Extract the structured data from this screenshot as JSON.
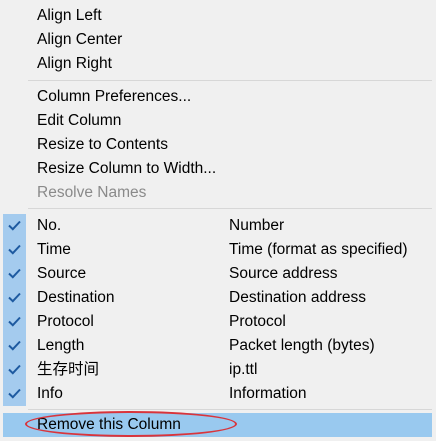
{
  "menu": {
    "align": [
      {
        "label": "Align Left"
      },
      {
        "label": "Align Center"
      },
      {
        "label": "Align Right"
      }
    ],
    "column_actions": [
      {
        "label": "Column Preferences...",
        "enabled": true
      },
      {
        "label": "Edit Column",
        "enabled": true
      },
      {
        "label": "Resize to Contents",
        "enabled": true
      },
      {
        "label": "Resize Column to Width...",
        "enabled": true
      },
      {
        "label": "Resolve Names",
        "enabled": false
      }
    ],
    "columns": [
      {
        "label": "No.",
        "desc": "Number",
        "checked": true
      },
      {
        "label": "Time",
        "desc": "Time (format as specified)",
        "checked": true
      },
      {
        "label": "Source",
        "desc": "Source address",
        "checked": true
      },
      {
        "label": "Destination",
        "desc": "Destination address",
        "checked": true
      },
      {
        "label": "Protocol",
        "desc": "Protocol",
        "checked": true
      },
      {
        "label": "Length",
        "desc": "Packet length (bytes)",
        "checked": true
      },
      {
        "label": "生存时间",
        "desc": "ip.ttl",
        "checked": true
      },
      {
        "label": "Info",
        "desc": "Information",
        "checked": true
      }
    ],
    "remove": {
      "label": "Remove this Column"
    }
  },
  "colors": {
    "check_bg": "#a4cbee",
    "check_mark": "#1e5aa0",
    "selected_bg": "#99c9ef",
    "annotation_ring": "#d9343b"
  }
}
